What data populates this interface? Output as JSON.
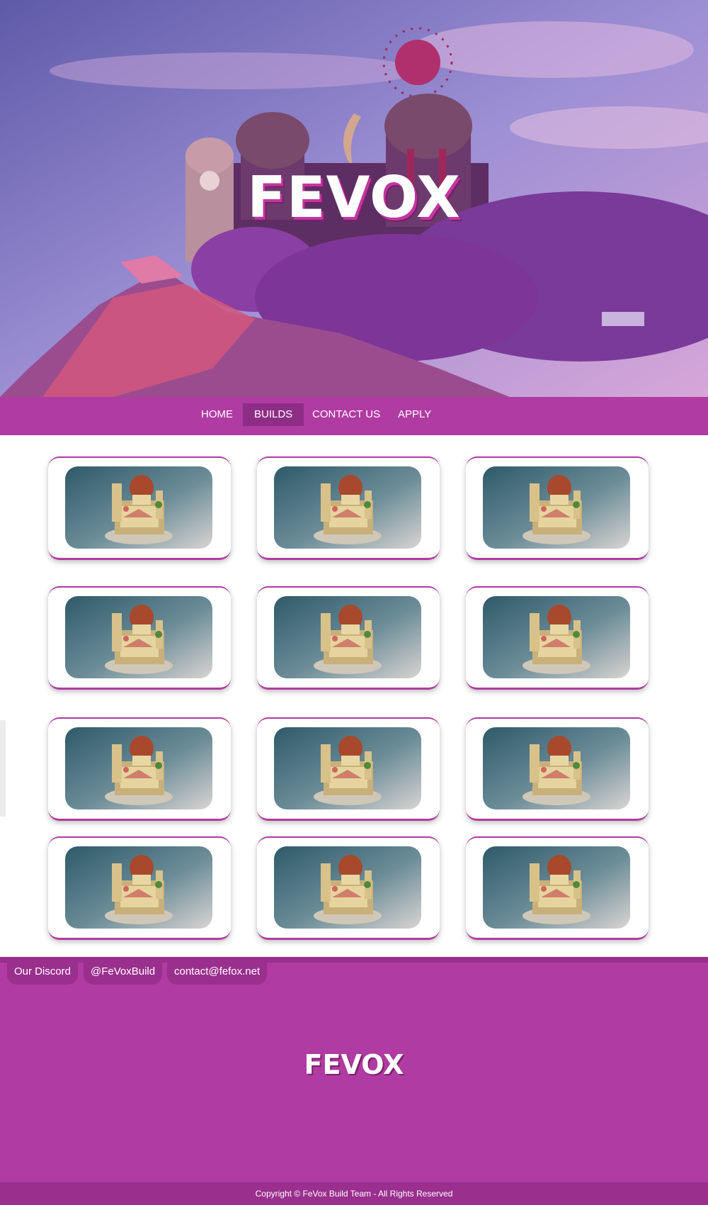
{
  "hero": {
    "title": "FEVOX"
  },
  "nav": {
    "items": [
      {
        "label": "HOME",
        "active": false
      },
      {
        "label": "BUILDS",
        "active": true
      },
      {
        "label": "CONTACT US",
        "active": false
      },
      {
        "label": "APPLY",
        "active": false
      }
    ]
  },
  "gallery": {
    "columns": 3,
    "rows": 4,
    "item_count": 12
  },
  "footer": {
    "links": [
      "Our Discord",
      "@FeVoxBuild",
      "contact@fefox.net"
    ],
    "logo": "FEVOX",
    "copyright": "Copyright © FeVox Build Team - All Rights Reserved"
  },
  "colors": {
    "brand": "#b03ba2",
    "brand_dark": "#9a2f8e",
    "nav_active": "#8e2d85"
  }
}
